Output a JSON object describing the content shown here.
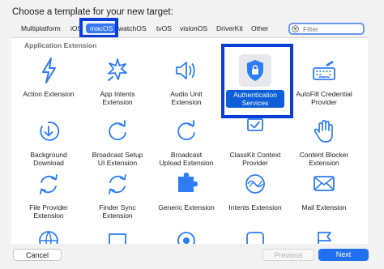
{
  "title": "Choose a template for your new target:",
  "tabs": [
    "Multiplatform",
    "iOS",
    "macOS",
    "watchOS",
    "tvOS",
    "visionOS",
    "DriverKit",
    "Other"
  ],
  "selected_tab": "macOS",
  "filter": {
    "placeholder": "Filter"
  },
  "section": "Application Extension",
  "templates": [
    {
      "label": "Action Extension",
      "icon": "bolt-icon"
    },
    {
      "label": "App Intents\nExtension",
      "icon": "app-intents-icon"
    },
    {
      "label": "Audio Unit\nExtension",
      "icon": "speaker-icon"
    },
    {
      "label": "Authentication\nServices",
      "icon": "shield-lock-icon",
      "selected": true
    },
    {
      "label": "AutoFill Credential\nProvider",
      "icon": "keyboard-icon"
    },
    {
      "label": "Background\nDownload",
      "icon": "download-arrow-icon"
    },
    {
      "label": "Broadcast Setup\nUI Extension",
      "icon": "circular-arrow-icon"
    },
    {
      "label": "Broadcast\nUpload Extension",
      "icon": "circular-arrow-icon"
    },
    {
      "label": "ClassKit Context\nProvider",
      "icon": "clipboard-icon"
    },
    {
      "label": "Content Blocker\nExtension",
      "icon": "hand-icon"
    },
    {
      "label": "File Provider\nExtension",
      "icon": "sync-arrows-icon"
    },
    {
      "label": "Finder Sync\nExtension",
      "icon": "sync-arrows-icon"
    },
    {
      "label": "Generic Extension",
      "icon": "puzzle-icon"
    },
    {
      "label": "Intents Extension",
      "icon": "intents-icon"
    },
    {
      "label": "Mail Extension",
      "icon": "envelope-icon"
    }
  ],
  "buttons": {
    "cancel": "Cancel",
    "previous": "Previous",
    "next": "Next"
  },
  "colors": {
    "accent": "#3478f6",
    "highlight_box": "#0a3cd6",
    "icon_blue": "#2d7cf6"
  }
}
